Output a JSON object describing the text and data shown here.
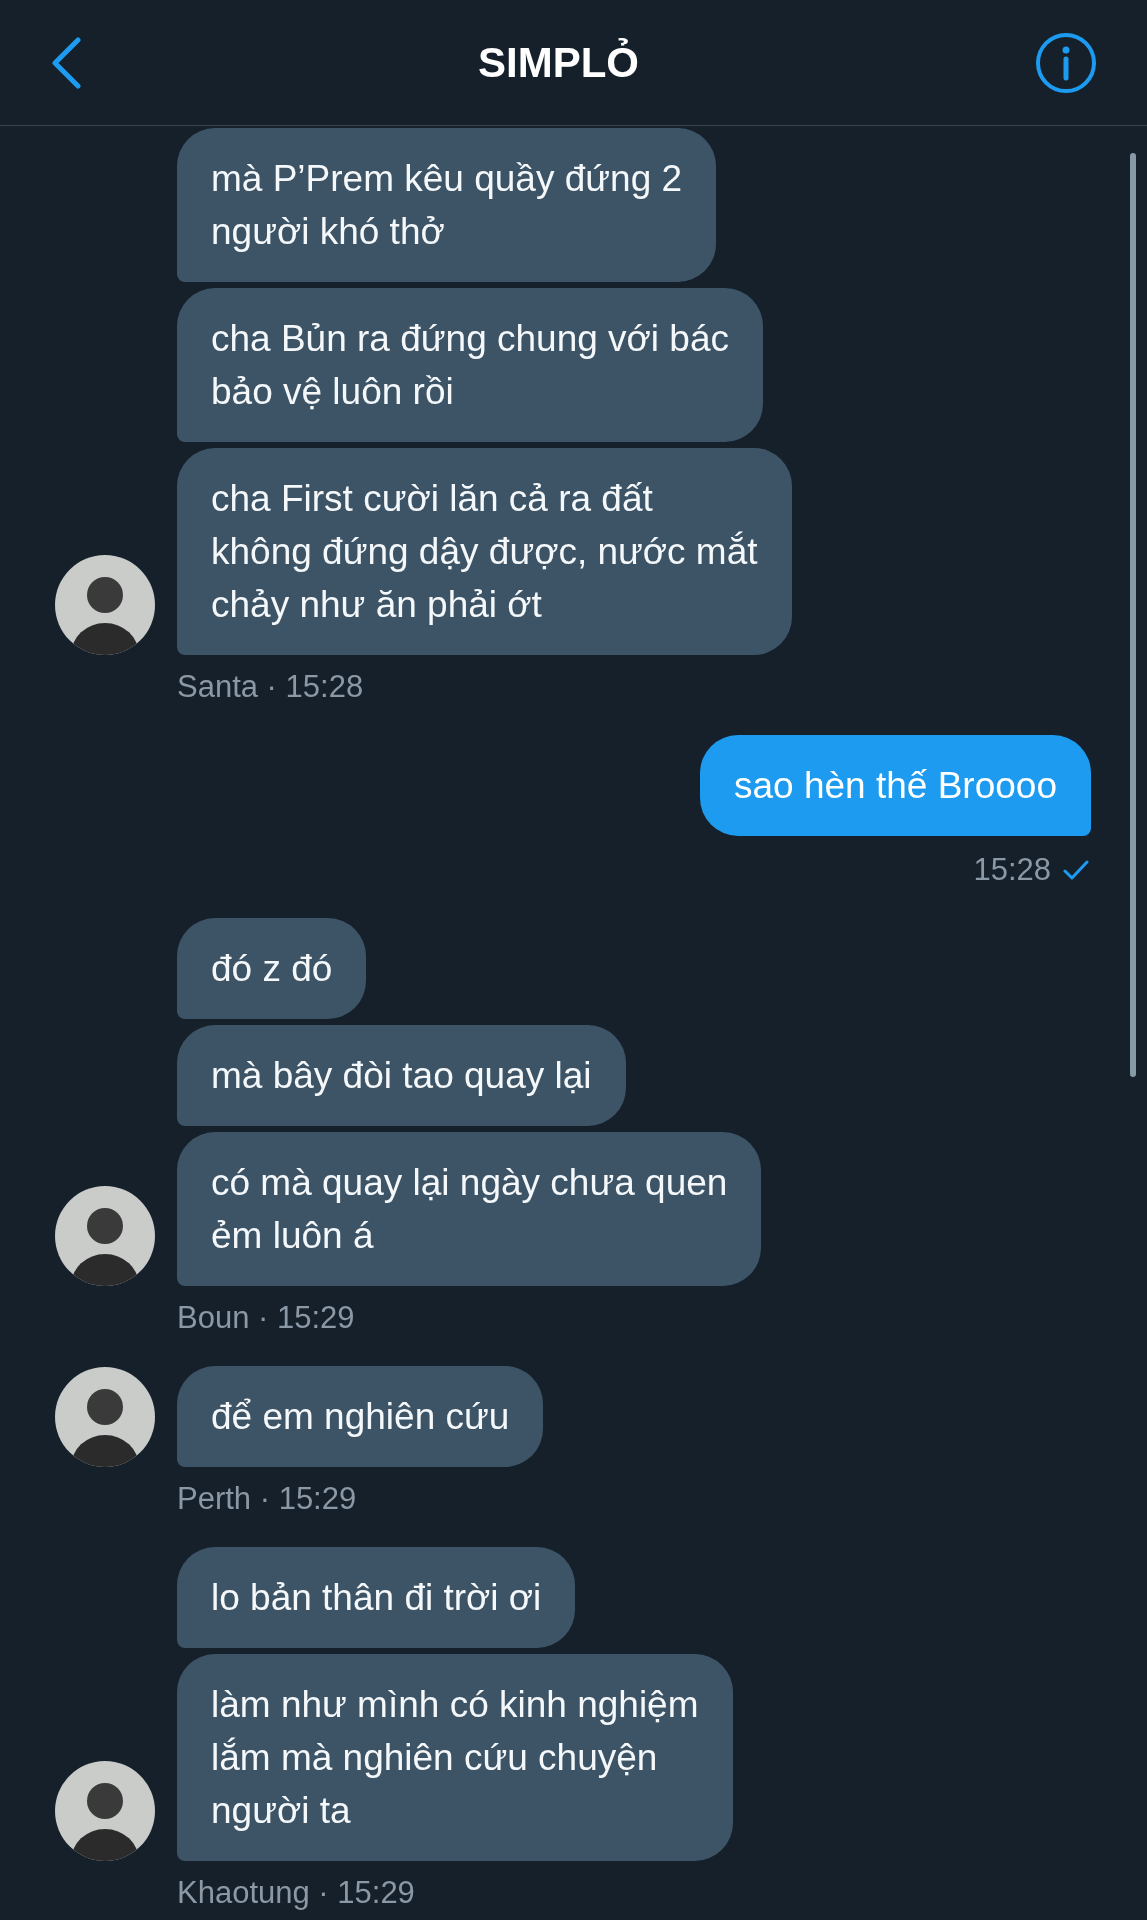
{
  "header": {
    "title": "SIMPLỎ"
  },
  "groups": [
    {
      "kind": "received",
      "messages": [
        "mà P’Prem kêu quầy đứng 2\nngười khó thở",
        "cha Bủn ra đứng chung với bác\nbảo vệ luôn rồi",
        "cha First cười lăn cả ra đất\nkhông đứng dậy được, nước mắt\nchảy như ăn phải ớt"
      ],
      "caption": "Santa · 15:28"
    },
    {
      "kind": "sent",
      "messages": [
        "sao hèn thế Broooo"
      ],
      "caption": "15:28",
      "read": true
    },
    {
      "kind": "received",
      "messages": [
        "đó z đó",
        "mà bây đòi tao quay lại",
        "có mà quay lại ngày chưa quen\nẻm luôn á"
      ],
      "caption": "Boun · 15:29"
    },
    {
      "kind": "received",
      "messages": [
        "để em nghiên cứu"
      ],
      "caption": "Perth · 15:29"
    },
    {
      "kind": "received",
      "messages": [
        "lo bản thân đi trời ơi",
        "làm như mình có kinh nghiệm\nlắm mà nghiên cứu chuyện\nngười ta"
      ],
      "caption": "Khaotung · 15:29"
    }
  ]
}
